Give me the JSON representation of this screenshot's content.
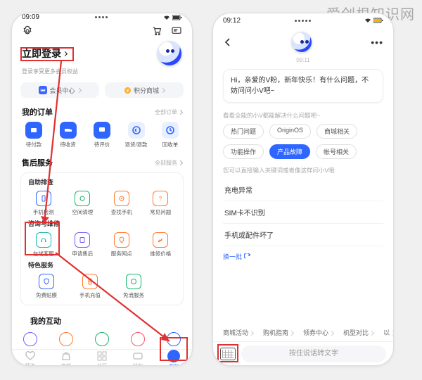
{
  "watermark": "爱创根知识网",
  "phoneA": {
    "status": {
      "time": "09:09"
    },
    "login": {
      "title": "立即登录",
      "subtitle": "登录享受更多会员权益"
    },
    "pills": {
      "vip": "会员中心",
      "points": "积分商城"
    },
    "orders": {
      "title": "我的订单",
      "more": "全部订单",
      "items": [
        "待付款",
        "待收货",
        "待评价",
        "退货/退款",
        "回收单"
      ]
    },
    "service": {
      "title": "售后服务",
      "more": "全部服务",
      "self": {
        "title": "自助排查",
        "items": [
          "手机检测",
          "空间清理",
          "查找手机",
          "常见问题"
        ]
      },
      "consult": {
        "title": "咨询与维修",
        "items": [
          "在线客服",
          "申请售后",
          "服务网点",
          "维修价格"
        ]
      },
      "special": {
        "title": "特色服务",
        "items": [
          "免费贴膜",
          "手机充值",
          "免流服务"
        ]
      }
    },
    "interact": {
      "title": "我的互动"
    },
    "tabs": [
      "精选",
      "商城",
      "社区",
      "钱包",
      "我的"
    ]
  },
  "phoneB": {
    "status": {
      "time": "09:12"
    },
    "chatTime": "09:11",
    "greeting": "Hi，亲爱的V粉，新年快乐！有什么问题，不妨问问小V吧~",
    "hint1": "看看全能的小V都能解决什么问题吧~",
    "chips": [
      "热门问题",
      "OriginOS",
      "商城相关",
      "功能操作",
      "产品故障",
      "帐号相关"
    ],
    "hint2": "您可以直接输入关键词或者像这样问小V哦",
    "questions": [
      "充电异常",
      "SIM卡不识别",
      "手机或配件坏了"
    ],
    "refresh": "换一批",
    "quick": [
      "商城活动",
      "购机指南",
      "领券中心",
      "机型对比",
      "以"
    ],
    "voice": "按住说话转文字"
  }
}
